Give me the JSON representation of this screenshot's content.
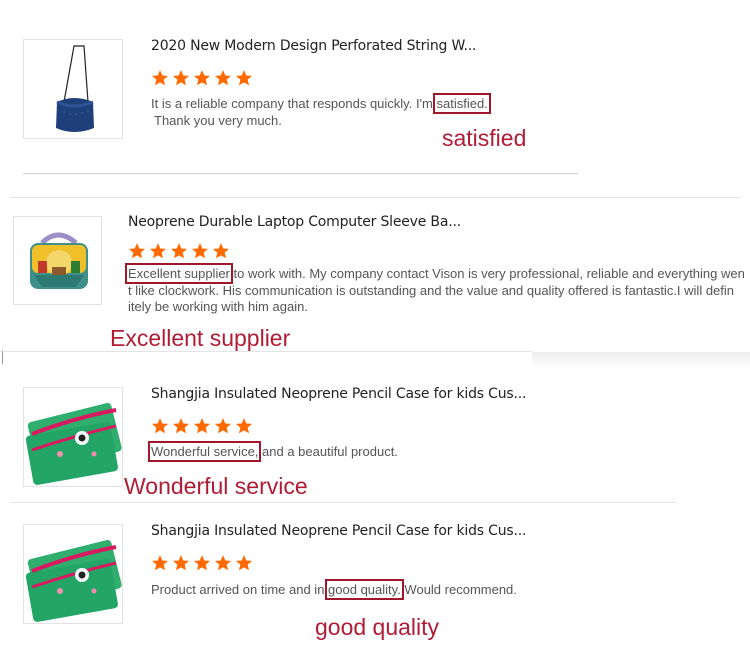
{
  "colors": {
    "star": "#ff6a00",
    "highlight_box": "#a0162a",
    "callout_text": "#b01c34",
    "body_text": "#555555",
    "title_text": "#222222"
  },
  "reviews": [
    {
      "product_image": "bucket-bag-image",
      "title": "2020 New Modern Design Perforated String W...",
      "rating": 5,
      "text_before": "It is a reliable company that responds quickly. I'm ",
      "highlight": "satisfied.",
      "text_after": "Thank you very much.",
      "callout": "satisfied"
    },
    {
      "product_image": "laptop-sleeve-image",
      "title": "Neoprene Durable Laptop Computer Sleeve Ba...",
      "rating": 5,
      "highlight": "Excellent supplier",
      "text_line1_rest": " to work with. My company contact Vison is very professional, reliable and everything wen",
      "text_line2": "t like clockwork. His communication is outstanding and the value and quality offered is fantastic.I will defin",
      "text_line3": "itely be working with him again.",
      "callout": "Excellent supplier"
    },
    {
      "product_image": "pencil-case-image",
      "title": "Shangjia Insulated Neoprene Pencil Case for kids Cus...",
      "rating": 5,
      "highlight": "Wonderful service,",
      "text_after": " and a beautiful product.",
      "callout": "Wonderful service"
    },
    {
      "product_image": "pencil-case-image",
      "title": "Shangjia Insulated Neoprene Pencil Case for kids Cus...",
      "rating": 5,
      "text_before": "Product arrived on time and in ",
      "highlight": "good quality.",
      "text_after": " Would recommend.",
      "callout": "good quality"
    }
  ]
}
